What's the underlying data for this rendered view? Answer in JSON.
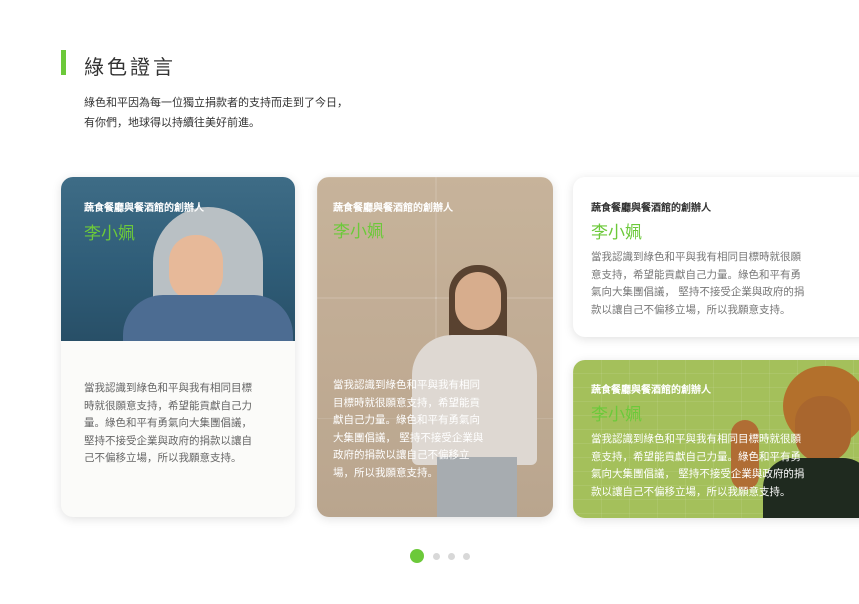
{
  "section": {
    "title": "綠色證言",
    "intro": [
      "綠色和平因為每一位獨立捐款者的支持而走到了今日，",
      "有你們，地球得以持續往美好前進。"
    ]
  },
  "cards": [
    {
      "subtitle": "蔬食餐廳與餐酒館的創辦人",
      "name": "李小姵",
      "quote": [
        "當我認識到綠色和平與我有相同目標",
        "時就很願意支持，希望能貢獻自己力",
        "量。綠色和平有勇氣向大集團倡議，",
        "堅持不接受企業與政府的捐款以讓自",
        "己不偏移立場，所以我願意支持。"
      ]
    },
    {
      "subtitle": "蔬食餐廳與餐酒館的創辦人",
      "name": "李小姵",
      "quote": [
        "當我認識到綠色和平與我有相同",
        "目標時就很願意支持，希望能貢",
        "獻自己力量。綠色和平有勇氣向",
        "大集團倡議， 堅持不接受企業與",
        "政府的捐款以讓自己不偏移立",
        "場，所以我願意支持。"
      ]
    },
    {
      "subtitle": "蔬食餐廳與餐酒館的創辦人",
      "name": "李小姵",
      "quote": [
        "當我認識到綠色和平與我有相同目標時就很願",
        "意支持，希望能貢獻自己力量。綠色和平有勇",
        "氣向大集團倡議， 堅持不接受企業與政府的捐",
        "款以讓自己不偏移立場，所以我願意支持。"
      ]
    },
    {
      "subtitle": "蔬食餐廳與餐酒館的創辦人",
      "name": "李小姵",
      "quote": [
        "當我認識到綠色和平與我有相同目標時就很願",
        "意支持，希望能貢獻自己力量。綠色和平有勇",
        "氣向大集團倡議， 堅持不接受企業與政府的捐",
        "款以讓自己不偏移立場，所以我願意支持。"
      ]
    }
  ],
  "pagination": {
    "count": 4,
    "active": 1
  },
  "colors": {
    "accent": "#6cc93a"
  }
}
